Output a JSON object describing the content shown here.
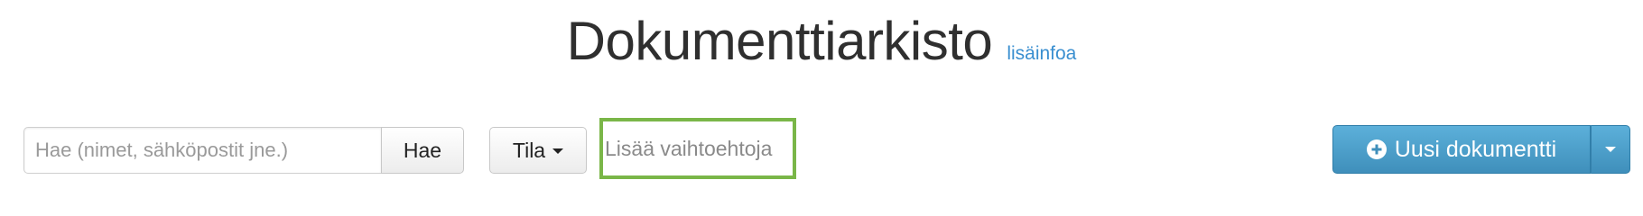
{
  "header": {
    "title": "Dokumenttiarkisto",
    "info_link": "lisäinfoa"
  },
  "search": {
    "placeholder": "Hae (nimet, sähköpostit jne.)",
    "value": "",
    "button_label": "Hae"
  },
  "status_filter": {
    "label": "Tila",
    "icon": "caret-down-icon"
  },
  "more_options": {
    "label": "Lisää vaihtoehtoja",
    "highlight_color": "#7ab648"
  },
  "new_document": {
    "label": "Uusi dokumentti",
    "icon": "plus-circle-icon",
    "dropdown_icon": "caret-down-icon",
    "color": "#4a9fcd"
  },
  "colors": {
    "link": "#3a8fd0",
    "title": "#2f2f2f"
  }
}
